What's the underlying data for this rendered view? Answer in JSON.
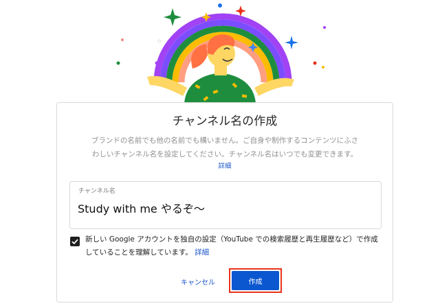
{
  "dialog": {
    "title": "チャンネル名の作成",
    "description_line1": "ブランドの名前でも他の名前でも構いません。ご自身や制作するコンテンツにふさ",
    "description_line2": "わしいチャンネル名を設定してください。チャンネル名はいつでも変更できます。",
    "learn_more": "詳細"
  },
  "channel_name_field": {
    "label": "チャンネル名",
    "value": "Study with me やるぞ〜"
  },
  "consent": {
    "checked": true,
    "text": "新しい Google アカウントを独自の設定（YouTube での検索履歴と再生履歴など）で作成していることを理解しています。",
    "link": "詳細"
  },
  "buttons": {
    "cancel": "キャンセル",
    "create": "作成"
  },
  "colors": {
    "accent_blue": "#0b57d0",
    "link_blue": "#1a56c9",
    "highlight_red": "#e8321c"
  },
  "illustration": {
    "icon": "rainbow-celebration-illustration"
  }
}
